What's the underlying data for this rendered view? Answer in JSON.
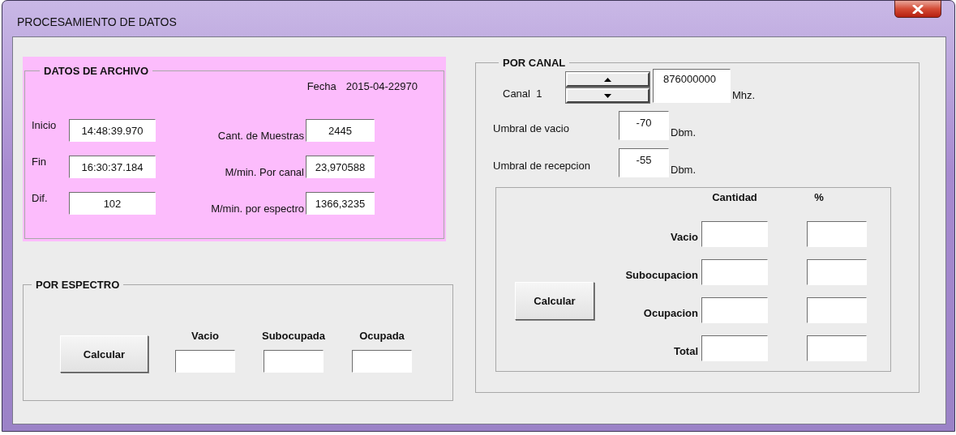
{
  "window": {
    "title": "PROCESAMIENTO DE DATOS"
  },
  "datos_de_archivo": {
    "title": "DATOS DE ARCHIVO",
    "fecha_label": "Fecha",
    "fecha": "2015-04-22970",
    "fields": [
      {
        "label": "Inicio",
        "value": "14:48:39.970"
      },
      {
        "label": "Fin",
        "value": "16:30:37.184"
      },
      {
        "label": "Dif.",
        "value": "102"
      }
    ],
    "stats": [
      {
        "label": "Cant. de Muestras",
        "value": "2445"
      },
      {
        "label": "M/min. Por canal",
        "value": "23,970588"
      },
      {
        "label": "M/min. por espectro",
        "value": "1366,3235"
      }
    ]
  },
  "por_espectro": {
    "title": "POR ESPECTRO",
    "button": "Calcular",
    "columns": [
      "Vacio",
      "Subocupada",
      "Ocupada"
    ]
  },
  "por_canal": {
    "title": "POR CANAL",
    "canal_label": "Canal",
    "canal": "1",
    "frequency": "876000000",
    "frequency_unit": "Mhz.",
    "thresholds": [
      {
        "label": "Umbral de vacio",
        "value": "-70",
        "unit": "Dbm."
      },
      {
        "label": "Umbral de recepcion",
        "value": "-55",
        "unit": "Dbm."
      }
    ],
    "button": "Calcular",
    "columns": [
      "Cantidad",
      "%"
    ],
    "rows": [
      "Vacio",
      "Subocupacion",
      "Ocupacion",
      "Total"
    ]
  }
}
